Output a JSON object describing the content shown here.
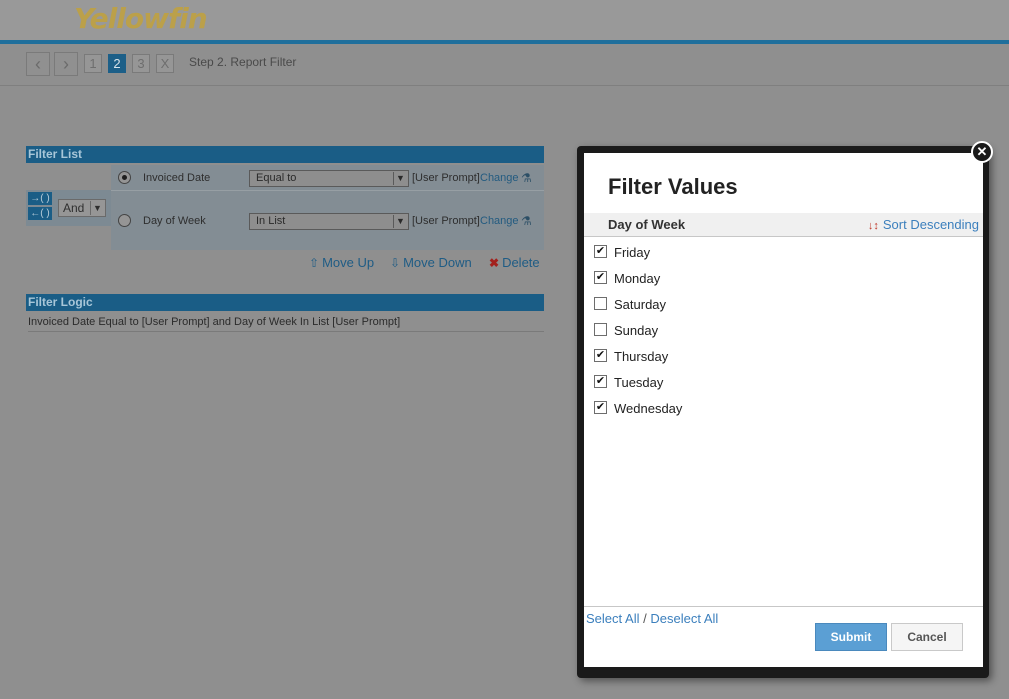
{
  "app": {
    "logo_text": "Yellowfin"
  },
  "stepbar": {
    "back": "‹",
    "forward": "›",
    "steps": [
      "1",
      "2",
      "3",
      "X"
    ],
    "active_step": "2",
    "label": "Step 2. Report Filter"
  },
  "filter_list": {
    "heading": "Filter List",
    "join_operator": "And",
    "filters": [
      {
        "field": "Invoiced Date",
        "operator": "Equal to",
        "value": "[User Prompt]",
        "change": "Change",
        "selected": true
      },
      {
        "field": "Day of Week",
        "operator": "In List",
        "value": "[User Prompt]",
        "change": "Change",
        "selected": false
      }
    ],
    "actions": {
      "move_up": "Move Up",
      "move_down": "Move Down",
      "delete": "Delete"
    }
  },
  "filter_logic": {
    "heading": "Filter Logic",
    "text": "Invoiced Date Equal to [User Prompt] and Day of Week In List [User Prompt]"
  },
  "dialog": {
    "title": "Filter Values",
    "column": "Day of Week",
    "sort_label": "Sort Descending",
    "values": [
      {
        "label": "Friday",
        "checked": true
      },
      {
        "label": "Monday",
        "checked": true
      },
      {
        "label": "Saturday",
        "checked": false
      },
      {
        "label": "Sunday",
        "checked": false
      },
      {
        "label": "Thursday",
        "checked": true
      },
      {
        "label": "Tuesday",
        "checked": true
      },
      {
        "label": "Wednesday",
        "checked": true
      }
    ],
    "select_all": "Select All",
    "separator": "/",
    "deselect_all": "Deselect All",
    "submit": "Submit",
    "cancel": "Cancel"
  }
}
